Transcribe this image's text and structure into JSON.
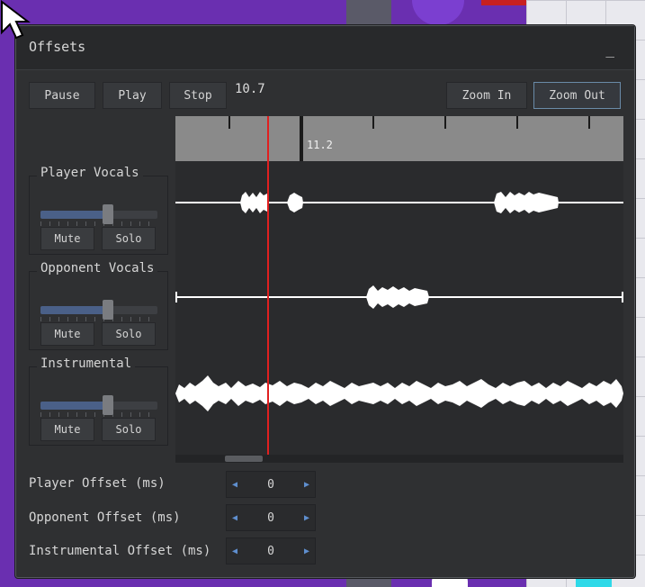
{
  "window": {
    "title": "Offsets",
    "minimize_label": "_"
  },
  "transport": {
    "pause_label": "Pause",
    "play_label": "Play",
    "stop_label": "Stop",
    "time_display": "10.7",
    "zoom_in_label": "Zoom In",
    "zoom_out_label": "Zoom Out"
  },
  "timeline": {
    "marker_label": "11.2"
  },
  "tracks": [
    {
      "name": "Player Vocals",
      "volume": 0.58,
      "mute_label": "Mute",
      "solo_label": "Solo"
    },
    {
      "name": "Opponent Vocals",
      "volume": 0.58,
      "mute_label": "Mute",
      "solo_label": "Solo"
    },
    {
      "name": "Instrumental",
      "volume": 0.58,
      "mute_label": "Mute",
      "solo_label": "Solo"
    }
  ],
  "offsets": [
    {
      "label": "Player Offset (ms)",
      "value": "0"
    },
    {
      "label": "Opponent Offset (ms)",
      "value": "0"
    },
    {
      "label": "Instrumental Offset (ms)",
      "value": "0"
    }
  ],
  "colors": {
    "playhead": "#e02020",
    "volume_fill": "#4a6088",
    "accent_border": "#6a8ba8"
  },
  "icons": {
    "cursor": "arrow-cursor-icon",
    "spin_left": "triangle-left-icon",
    "spin_right": "triangle-right-icon"
  }
}
